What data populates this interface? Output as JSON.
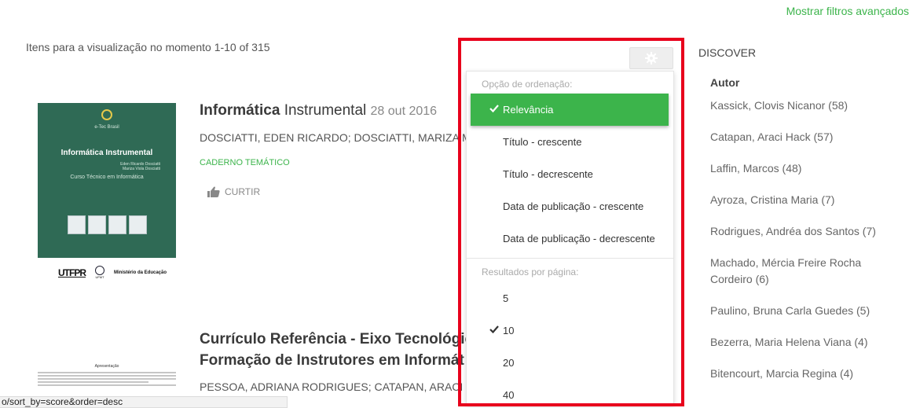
{
  "header": {
    "advanced_filters": "Mostrar filtros avançados"
  },
  "results": {
    "count_text": "Itens para a visualização no momento 1-10 of 315"
  },
  "items": [
    {
      "title_a": "Informática",
      "title_b": " Instrumental",
      "date": "28 out 2016",
      "authors": "DOSCIATTI, EDEN RICARDO; DOSCIATTI, MARIZA MIC",
      "type": "CADERNO TEMÁTICO",
      "like_label": "CURTIR",
      "thumbnail": {
        "brand": "e-Tec Brasil",
        "title": "Informática Instrumental",
        "authors_line1": "Eden Ricardo Dosciatti",
        "authors_line2": "Mariza Viola Dosciatti",
        "subtitle": "Curso Técnico em Informática",
        "footer_utf": "UTFPR",
        "footer_seal": "UFMT",
        "footer_ministry": "Ministério da Educação"
      }
    },
    {
      "title_line1": "Currículo Referência - Eixo Tecnológic",
      "title_line2_a": "Formação de Instrutores em ",
      "title_line2_b": "Informát",
      "authors": "PESSOA, ADRIANA RODRIGUES; CATAPAN, ARACI HA",
      "thumbnail": {
        "heading": "Apresentação"
      }
    }
  ],
  "sort_menu": {
    "sort_header": "Opção de ordenação:",
    "sort_options": [
      {
        "label": "Relevância",
        "selected": true
      },
      {
        "label": "Título - crescente",
        "selected": false
      },
      {
        "label": "Título - decrescente",
        "selected": false
      },
      {
        "label": "Data de publicação - crescente",
        "selected": false
      },
      {
        "label": "Data de publicação - decrescente",
        "selected": false
      }
    ],
    "rpp_header": "Resultados por página:",
    "rpp_options": [
      {
        "label": "5",
        "selected": false
      },
      {
        "label": "10",
        "selected": true
      },
      {
        "label": "20",
        "selected": false
      },
      {
        "label": "40",
        "selected": false
      }
    ]
  },
  "sidebar": {
    "title": "DISCOVER",
    "facet_title": "Autor",
    "facets": [
      "Kassick, Clovis Nicanor (58)",
      "Catapan, Araci Hack (57)",
      "Laffin, Marcos (48)",
      "Ayroza, Cristina Maria (7)",
      "Rodrigues, Andréa dos Santos (7)",
      "Machado, Mércia Freire Rocha Cordeiro (6)",
      "Paulino, Bruna Carla Guedes (5)",
      "Bezerra, Maria Helena Viana (4)",
      "Bitencourt, Marcia Regina (4)"
    ]
  },
  "status_bar": {
    "url": "o/sort_by=score&order=desc"
  },
  "colors": {
    "accent": "#3cb44b",
    "highlight_frame": "#e8001c"
  }
}
